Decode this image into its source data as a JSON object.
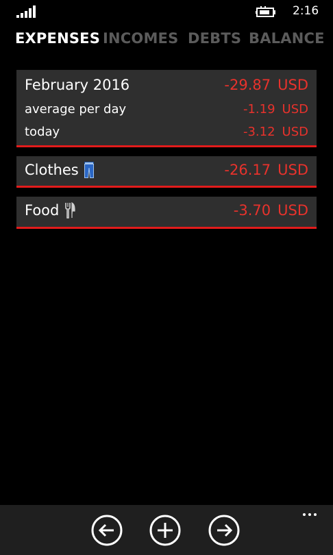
{
  "status_bar": {
    "time": "2:16",
    "signal_icon": "signal-icon",
    "battery_icon": "battery-charging-icon"
  },
  "pivot": {
    "tabs": [
      {
        "label": "EXPENSES",
        "active": true
      },
      {
        "label": "INCOMES",
        "active": false
      },
      {
        "label": "DEBTS",
        "active": false
      },
      {
        "label": "BALANCE",
        "active": false
      }
    ]
  },
  "summary": {
    "month_label": "February 2016",
    "month_value": "-29.87",
    "month_currency": "USD",
    "avg_label": "average per day",
    "avg_value": "-1.19",
    "avg_currency": "USD",
    "today_label": "today",
    "today_value": "-3.12",
    "today_currency": "USD"
  },
  "categories": [
    {
      "name": "Clothes",
      "icon": "jeans-icon",
      "value": "-26.17",
      "currency": "USD"
    },
    {
      "name": "Food",
      "icon": "fork-knife-icon",
      "value": "-3.70",
      "currency": "USD"
    }
  ],
  "app_bar": {
    "buttons": [
      "previous-arrow-icon",
      "add-icon",
      "next-arrow-icon"
    ],
    "more_icon": "more-dots-icon"
  },
  "colors": {
    "accent": "#e21b1b",
    "amount": "#e8322c",
    "card_bg": "#2f2f2f",
    "inactive_tab": "#5b5b5b"
  }
}
